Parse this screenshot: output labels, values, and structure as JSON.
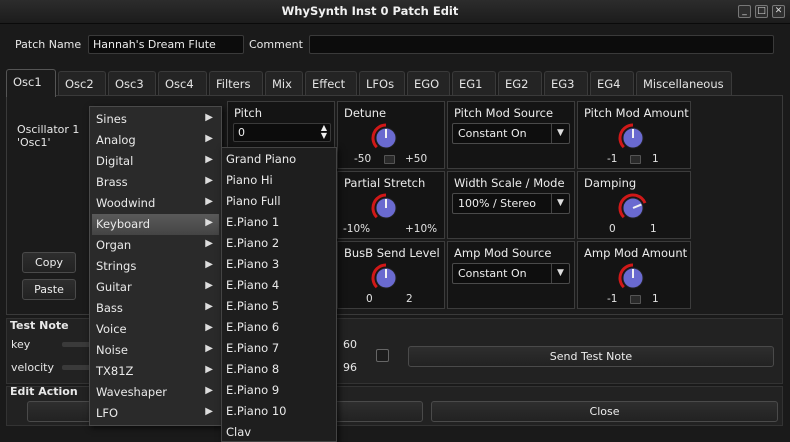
{
  "window": {
    "title": "WhySynth Inst 0 Patch Edit",
    "buttons": [
      "_",
      "□",
      "✕"
    ]
  },
  "patch": {
    "name_label": "Patch Name",
    "name_value": "Hannah's Dream Flute",
    "comment_label": "Comment",
    "comment_value": ""
  },
  "tabs": [
    "Osc1",
    "Osc2",
    "Osc3",
    "Osc4",
    "Filters",
    "Mix",
    "Effect",
    "LFOs",
    "EGO",
    "EG1",
    "EG2",
    "EG3",
    "EG4",
    "Miscellaneous"
  ],
  "osc": {
    "title_line1": "Oscillator 1",
    "title_line2": "'Osc1'",
    "copy": "Copy",
    "paste": "Paste"
  },
  "pitch": {
    "label": "Pitch",
    "value": "0"
  },
  "detune": {
    "label": "Detune",
    "min": "-50",
    "max": "+50",
    "value": 0.5
  },
  "pitch_mod_source": {
    "label": "Pitch Mod Source",
    "value": "Constant On"
  },
  "pitch_mod_amount": {
    "label": "Pitch Mod Amount",
    "min": "-1",
    "max": "1",
    "value": 0.5
  },
  "partial_stretch": {
    "label": "Partial Stretch",
    "min": "-10%",
    "max": "+10%",
    "value": 0.5
  },
  "width_scale": {
    "label": "Width Scale / Mode",
    "value": "100% / Stereo"
  },
  "damping": {
    "label": "Damping",
    "min": "0",
    "max": "1",
    "value": 0.75
  },
  "busb_send": {
    "label": "BusB Send Level",
    "min": "0",
    "max": "2",
    "value": 0.5
  },
  "amp_mod_source": {
    "label": "Amp Mod Source",
    "value": "Constant On"
  },
  "amp_mod_amount": {
    "label": "Amp Mod Amount",
    "min": "-1",
    "max": "1",
    "value": 0.5
  },
  "test_note": {
    "heading": "Test Note",
    "key_label": "key",
    "key_value": "60",
    "velocity_label": "velocity",
    "velocity_value": "96",
    "send_button": "Send Test Note"
  },
  "edit_action": {
    "heading": "Edit Action",
    "close_button": "Close"
  },
  "menu": {
    "categories": [
      "Sines",
      "Analog",
      "Digital",
      "Brass",
      "Woodwind",
      "Keyboard",
      "Organ",
      "Strings",
      "Guitar",
      "Bass",
      "Voice",
      "Noise",
      "TX81Z",
      "Waveshaper",
      "LFO"
    ],
    "selected": "Keyboard",
    "submenu": [
      "Grand Piano",
      "Piano Hi",
      "Piano Full",
      "E.Piano 1",
      "E.Piano 2",
      "E.Piano 3",
      "E.Piano 4",
      "E.Piano 5",
      "E.Piano 6",
      "E.Piano 7",
      "E.Piano 8",
      "E.Piano 9",
      "E.Piano 10",
      "Clav"
    ]
  },
  "colors": {
    "knob_arc": "#d01818",
    "knob_body": "#6a6ad0",
    "background": "#1a1a1a"
  }
}
